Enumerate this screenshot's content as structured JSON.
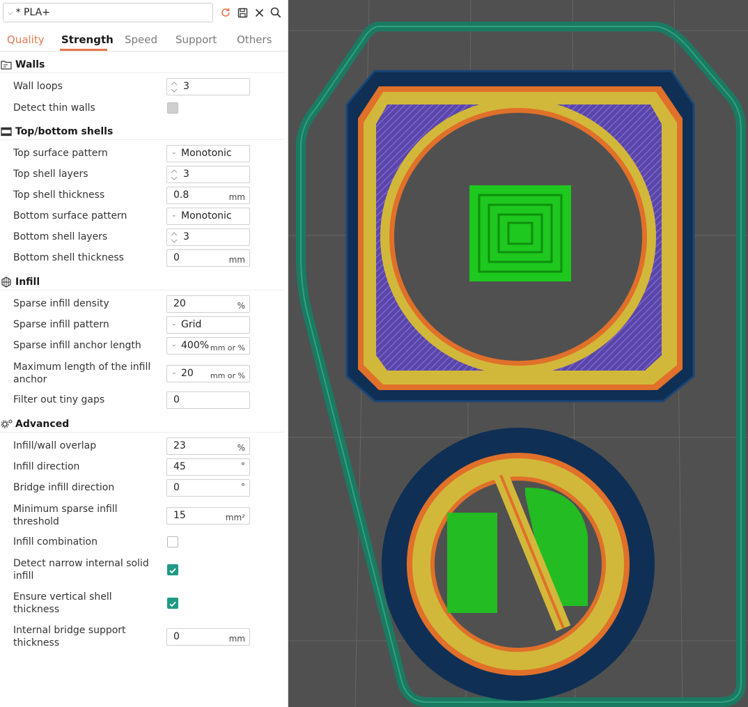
{
  "preset": {
    "name": "* PLA+"
  },
  "toolbar": {
    "icons": [
      "reset-icon",
      "save-icon",
      "close-icon",
      "search-icon"
    ],
    "accent": "#e8744a"
  },
  "tabs": [
    {
      "label": "Quality",
      "active": false
    },
    {
      "label": "Strength",
      "active": true
    },
    {
      "label": "Speed",
      "active": false
    },
    {
      "label": "Support",
      "active": false
    },
    {
      "label": "Others",
      "active": false
    }
  ],
  "sections": {
    "walls": {
      "title": "Walls",
      "wall_loops": {
        "label": "Wall loops",
        "value": "3"
      },
      "detect_thin_walls": {
        "label": "Detect thin walls",
        "checked": false,
        "disabled": true
      }
    },
    "shells": {
      "title": "Top/bottom shells",
      "top_surface_pattern": {
        "label": "Top surface pattern",
        "value": "Monotonic"
      },
      "top_shell_layers": {
        "label": "Top shell layers",
        "value": "3"
      },
      "top_shell_thickness": {
        "label": "Top shell thickness",
        "value": "0.8",
        "unit": "mm"
      },
      "bottom_surface_pattern": {
        "label": "Bottom surface pattern",
        "value": "Monotonic"
      },
      "bottom_shell_layers": {
        "label": "Bottom shell layers",
        "value": "3"
      },
      "bottom_shell_thickness": {
        "label": "Bottom shell thickness",
        "value": "0",
        "unit": "mm"
      }
    },
    "infill": {
      "title": "Infill",
      "sparse_infill_density": {
        "label": "Sparse infill density",
        "value": "20",
        "unit": "%"
      },
      "sparse_infill_pattern": {
        "label": "Sparse infill pattern",
        "value": "Grid"
      },
      "anchor_length": {
        "label": "Sparse infill anchor length",
        "value": "400%",
        "unit": "mm or %"
      },
      "max_anchor_length": {
        "label_line1": "Maximum length of the infill",
        "label_line2": "anchor",
        "value": "20",
        "unit": "mm or %"
      },
      "filter_tiny_gaps": {
        "label": "Filter out tiny gaps",
        "value": "0"
      }
    },
    "advanced": {
      "title": "Advanced",
      "infill_wall_overlap": {
        "label": "Infill/wall overlap",
        "value": "23",
        "unit": "%"
      },
      "infill_direction": {
        "label": "Infill direction",
        "value": "45",
        "unit": "°"
      },
      "bridge_infill_direction": {
        "label": "Bridge infill direction",
        "value": "0",
        "unit": "°"
      },
      "min_sparse_infill_threshold": {
        "label_line1": "Minimum sparse infill",
        "label_line2": "threshold",
        "value": "15",
        "unit": "mm²"
      },
      "infill_combination": {
        "label": "Infill combination",
        "checked": false
      },
      "detect_narrow_internal_solid_infill": {
        "label_line1": "Detect narrow internal solid",
        "label_line2": "infill",
        "checked": true
      },
      "ensure_vertical_shell_thickness": {
        "label_line1": "Ensure vertical shell",
        "label_line2": "thickness",
        "checked": true
      },
      "internal_bridge_support_thickness": {
        "label_line1": "Internal bridge support",
        "label_line2": "thickness",
        "value": "0",
        "unit": "mm"
      }
    }
  },
  "colors": {
    "brim": "#1b7a62",
    "outer_wall": "#0f2f55",
    "inner_wall": "#e0702a",
    "perimeter": "#d2b83a",
    "solid_infill": "#6a4fb8",
    "top_surface": "#1ec81e",
    "viewport_bg": "#505050",
    "check": "#1f9a86"
  }
}
